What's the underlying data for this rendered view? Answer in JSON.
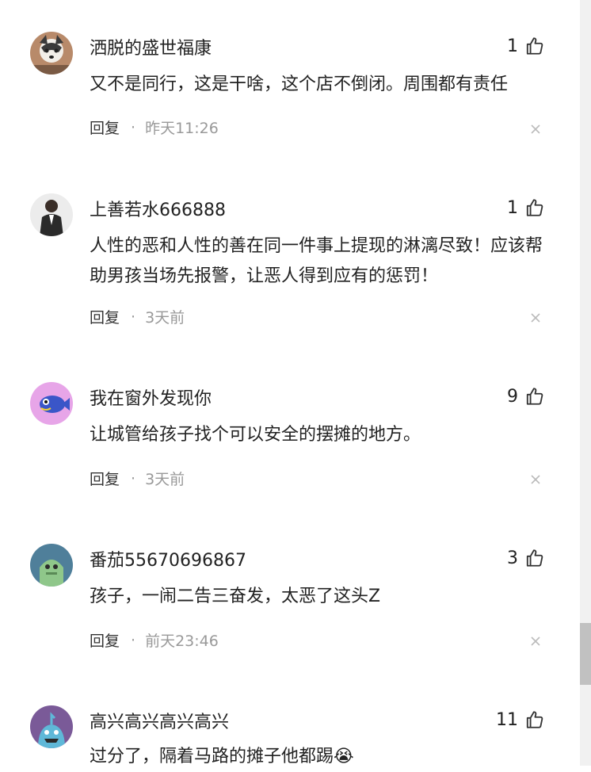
{
  "comments": [
    {
      "username": "洒脱的盛世福康",
      "likes": "1",
      "text": "又不是同行，这是干啥，这个店不倒闭。周围都有责任",
      "reply_label": "回复",
      "separator": "·",
      "time": "昨天11:26"
    },
    {
      "username": "上善若水666888",
      "likes": "1",
      "text": "人性的恶和人性的善在同一件事上提现的淋漓尽致！应该帮助男孩当场先报警，让恶人得到应有的惩罚！",
      "reply_label": "回复",
      "separator": "·",
      "time": "3天前"
    },
    {
      "username": "我在窗外发现你",
      "likes": "9",
      "text": "让城管给孩子找个可以安全的摆摊的地方。",
      "reply_label": "回复",
      "separator": "·",
      "time": "3天前"
    },
    {
      "username": "番茄55670696867",
      "likes": "3",
      "text": "孩子，一闹二告三奋发，太恶了这头Z",
      "reply_label": "回复",
      "separator": "·",
      "time": "前天23:46"
    },
    {
      "username": "高兴高兴高兴高兴",
      "likes": "11",
      "text": "过分了，隔着马路的摊子他都踢😭",
      "reply_label": "",
      "separator": "",
      "time": ""
    }
  ],
  "icons": {
    "like": "thumbs-up-icon",
    "close": "close-icon"
  },
  "colors": {
    "text": "#222222",
    "meta": "#999999",
    "background": "#ffffff"
  }
}
